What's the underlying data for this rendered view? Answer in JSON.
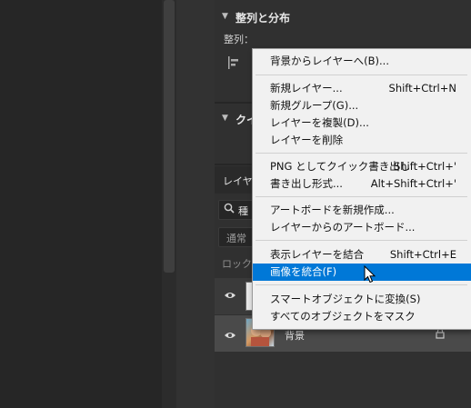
{
  "align_panel": {
    "title": "整列と分布",
    "align_label": "整列："
  },
  "quick_section": {
    "title_partial": "クイ"
  },
  "layers_panel": {
    "tab_partial": "レイヤー",
    "search_partial": "種",
    "blend_partial": "通常",
    "lock_partial": "ロック：",
    "rows": [
      {
        "name": ""
      },
      {
        "name": "背景"
      }
    ]
  },
  "context_menu": {
    "groups": [
      [
        {
          "label": "背景からレイヤーへ(B)...",
          "shortcut": ""
        }
      ],
      [
        {
          "label": "新規レイヤー...",
          "shortcut": "Shift+Ctrl+N"
        },
        {
          "label": "新規グループ(G)...",
          "shortcut": ""
        },
        {
          "label": "レイヤーを複製(D)...",
          "shortcut": ""
        },
        {
          "label": "レイヤーを削除",
          "shortcut": ""
        }
      ],
      [
        {
          "label": "PNG としてクイック書き出し",
          "shortcut": "Shift+Ctrl+'"
        },
        {
          "label": "書き出し形式...",
          "shortcut": "Alt+Shift+Ctrl+'"
        }
      ],
      [
        {
          "label": "アートボードを新規作成...",
          "shortcut": ""
        },
        {
          "label": "レイヤーからのアートボード...",
          "shortcut": ""
        }
      ],
      [
        {
          "label": "表示レイヤーを結合",
          "shortcut": "Shift+Ctrl+E"
        },
        {
          "label": "画像を統合(F)",
          "shortcut": "",
          "highlighted": true
        }
      ],
      [
        {
          "label": "スマートオブジェクトに変換(S)",
          "shortcut": ""
        },
        {
          "label": "すべてのオブジェクトをマスク",
          "shortcut": ""
        }
      ]
    ]
  },
  "icons": [
    "chevron-down-icon",
    "align-left-icon",
    "search-icon",
    "eye-icon",
    "lock-icon",
    "mouse-cursor-icon"
  ],
  "colors": {
    "menu_highlight": "#0078d7",
    "panel_bg": "#303030",
    "menu_bg": "#f1f1f1"
  }
}
